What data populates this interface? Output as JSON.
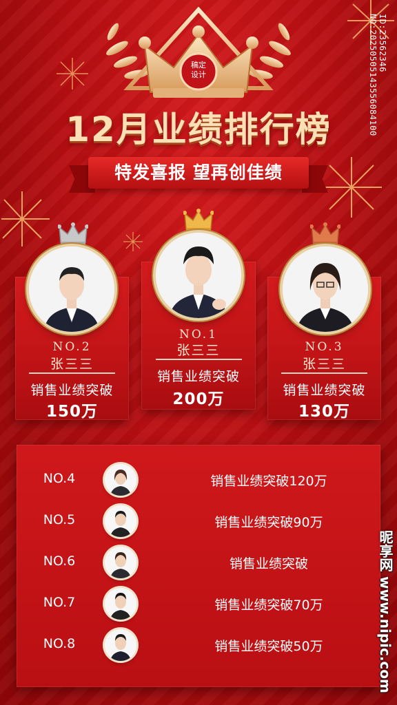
{
  "header": {
    "crown_badge_line1": "稿定",
    "crown_badge_line2": "设计",
    "title": "12月业绩排行榜",
    "subtitle": "特发喜报 望再创佳绩"
  },
  "podium": [
    {
      "rank": "NO.2",
      "name": "张三三",
      "text": "销售业绩突破",
      "value": "150万",
      "crown": "silver",
      "crown_color": "#c8c8c8"
    },
    {
      "rank": "NO.1",
      "name": "张三三",
      "text": "销售业绩突破",
      "value": "200万",
      "crown": "gold",
      "crown_color": "#f0b84a"
    },
    {
      "rank": "NO.3",
      "name": "张三三",
      "text": "销售业绩突破",
      "value": "130万",
      "crown": "bronze",
      "crown_color": "#e07a4a"
    }
  ],
  "ranking_list": [
    {
      "rank": "NO.4",
      "text": "销售业绩突破120万"
    },
    {
      "rank": "NO.5",
      "text": "销售业绩突破90万"
    },
    {
      "rank": "NO.6",
      "text": "销售业绩突破"
    },
    {
      "rank": "NO.7",
      "text": "销售业绩突破70万"
    },
    {
      "rank": "NO.8",
      "text": "销售业绩突破50万"
    }
  ],
  "watermark": {
    "id_text": "ID:23562346 NO:20250505143556084100",
    "site_text": "昵享网 www.nipic.com"
  },
  "colors": {
    "background": "#b80f12",
    "title_gold": "#fbe0b6",
    "frame_gold": "#b9863b"
  }
}
